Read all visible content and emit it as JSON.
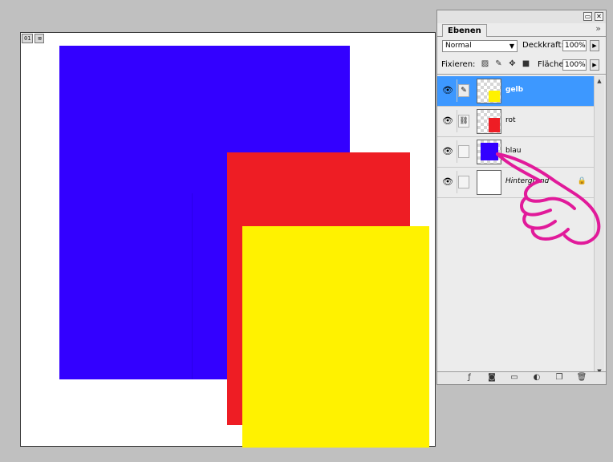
{
  "document": {
    "tab_number": "01",
    "tab_close": "⊠",
    "colors": {
      "blue": "#3300ff",
      "red": "#ee1d24",
      "yellow": "#fff200",
      "canvas": "#ffffff"
    }
  },
  "palette": {
    "tab_label": "Ebenen",
    "blend_mode": "Normal",
    "opacity_label": "Deckkraft:",
    "opacity_value": "100%",
    "lock_label": "Fixieren:",
    "fill_label": "Fläche",
    "fill_value": "100%",
    "selected_color": "#3d98ff",
    "layers": [
      {
        "name": "gelb",
        "thumb_color": "#fff200",
        "active": true,
        "icon": "brush-icon"
      },
      {
        "name": "rot",
        "thumb_color": "#ee1d24",
        "active": false,
        "icon": "link-icon"
      },
      {
        "name": "blau",
        "thumb_color": "#3300ff",
        "active": false,
        "icon": ""
      },
      {
        "name": "Hintergrund",
        "thumb_color": "#ffffff",
        "active": false,
        "icon": "",
        "locked": true
      }
    ],
    "bottom_icons": [
      "fx-icon",
      "mask-icon",
      "folder-icon",
      "adjustment-icon",
      "new-layer-icon",
      "trash-icon"
    ]
  },
  "overlay": {
    "hand_color": "#e11a9a"
  }
}
